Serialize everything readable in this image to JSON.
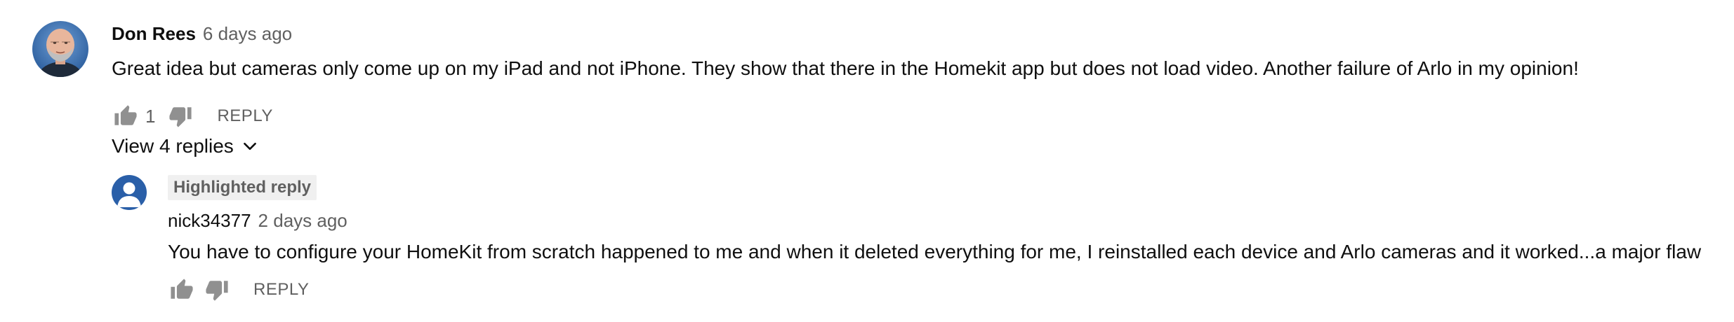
{
  "comment": {
    "author": "Don Rees",
    "timestamp": "6 days ago",
    "text": "Great idea but cameras only come up on my iPad and not iPhone. They show that there in the Homekit app but does not load video. Another failure of Arlo in my opinion!",
    "like_count": "1",
    "reply_label": "REPLY",
    "avatar_icon": "user-photo",
    "like_icon": "thumb-up-icon",
    "dislike_icon": "thumb-down-icon"
  },
  "replies_toggle": {
    "label": "View 4 replies",
    "icon": "chevron-down-icon"
  },
  "reply": {
    "badge": "Highlighted reply",
    "author": "nick34377",
    "timestamp": "2 days ago",
    "text": "You have to configure your HomeKit from scratch happened to me and when it deleted everything for me, I reinstalled each device and Arlo cameras and it worked...a major flaw",
    "reply_label": "REPLY",
    "avatar_icon": "default-user-avatar-icon"
  },
  "colors": {
    "primary_text": "#0f0f0f",
    "secondary_text": "#606060",
    "icon": "#909090",
    "badge_bg": "#f0f0f0",
    "default_avatar": "#2a5fa8"
  }
}
